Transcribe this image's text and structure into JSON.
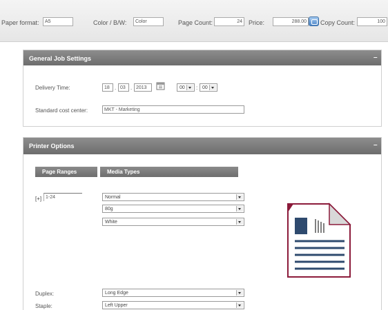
{
  "topbar": {
    "paper_format_label": "Paper format:",
    "paper_format_value": "A5",
    "color_label": "Color / B/W:",
    "color_value": "Color",
    "page_count_label": "Page Count:",
    "page_count_value": "24",
    "price_label": "Price:",
    "price_value": "288.00",
    "copy_count_label": "Copy Count:",
    "copy_count_value": "100",
    "calc_icon": "calculator-icon"
  },
  "general": {
    "title": "General Job Settings",
    "collapse": "–",
    "delivery_label": "Delivery Time:",
    "day": "18",
    "month": "03",
    "year": "2013",
    "hour": "00",
    "minute": "00",
    "sep_dot": ".",
    "sep_colon": ":",
    "cost_center_label": "Standard cost center:",
    "cost_center_value": "MKT - Marketing",
    "calendar_icon": "calendar-icon"
  },
  "printer": {
    "title": "Printer Options",
    "collapse": "–",
    "page_ranges_header": "Page Ranges",
    "media_types_header": "Media Types",
    "add_range": "[+]",
    "page_range_value": "1-24",
    "media_type": "Normal",
    "media_weight": "80g",
    "media_color": "White",
    "duplex_label": "Duplex:",
    "duplex_value": "Long Edge",
    "staple_label": "Staple:",
    "staple_value": "Left Upper",
    "preview_icon": "document-preview-icon",
    "accent_color": "#8b1a3a"
  }
}
